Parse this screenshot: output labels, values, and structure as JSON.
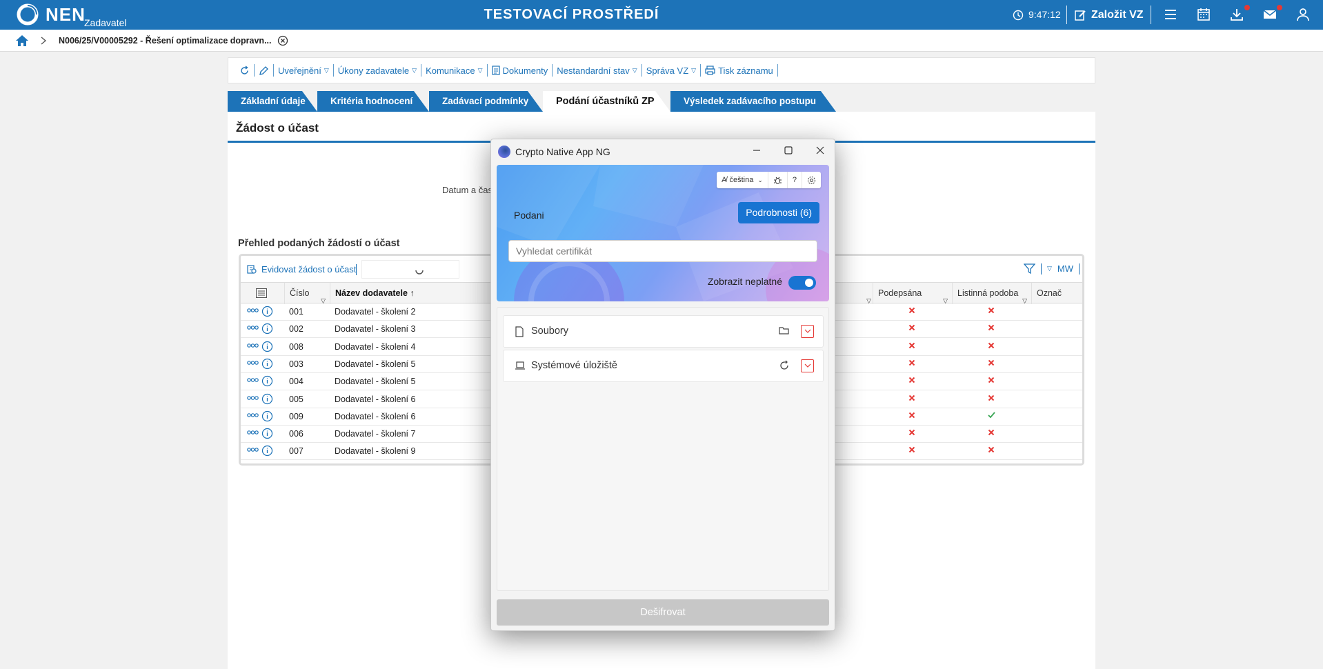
{
  "topbar": {
    "logo_text": "NEN",
    "logo_sub": "Zadavatel",
    "env_title": "TESTOVACÍ PROSTŘEDÍ",
    "time": "9:47:12",
    "create_label": "Založit VZ",
    "brand_color": "#1d73b8"
  },
  "breadcrumb": {
    "title": "N006/25/V00005292 - Řešení optimalizace dopravn..."
  },
  "toolbar": {
    "items": [
      "Uveřejnění",
      "Úkony zadavatele",
      "Komunikace",
      "Dokumenty",
      "Nestandardní stav",
      "Správa VZ",
      "Tisk záznamu"
    ]
  },
  "tabs": [
    "Základní údaje",
    "Kritéria hodnocení",
    "Zadávací podmínky",
    "Podání účastníků ZP",
    "Výsledek zadávacího postupu"
  ],
  "panel": {
    "title": "Žádost o účast",
    "datum_label": "Datum a čas",
    "section_title": "Přehled podaných žádostí o účast",
    "evidovat_label": "Evidovat žádost o účast",
    "mw_label": "MW"
  },
  "grid": {
    "columns": [
      "Číslo",
      "Název dodavatele",
      "Podepsána",
      "Listinná podoba",
      "Označ"
    ],
    "rows": [
      {
        "cislo": "001",
        "nazev": "Dodavatel - školení 2",
        "podepsana": "no",
        "listinna": "no"
      },
      {
        "cislo": "002",
        "nazev": "Dodavatel - školení 3",
        "podepsana": "no",
        "listinna": "no"
      },
      {
        "cislo": "008",
        "nazev": "Dodavatel - školení 4",
        "podepsana": "no",
        "listinna": "no"
      },
      {
        "cislo": "003",
        "nazev": "Dodavatel - školení 5",
        "podepsana": "no",
        "listinna": "no"
      },
      {
        "cislo": "004",
        "nazev": "Dodavatel - školení 5",
        "podepsana": "no",
        "listinna": "no"
      },
      {
        "cislo": "005",
        "nazev": "Dodavatel - školení 6",
        "podepsana": "no",
        "listinna": "no"
      },
      {
        "cislo": "009",
        "nazev": "Dodavatel - školení 6",
        "podepsana": "no",
        "listinna": "yes"
      },
      {
        "cislo": "006",
        "nazev": "Dodavatel - školení 7",
        "podepsana": "no",
        "listinna": "no"
      },
      {
        "cislo": "007",
        "nazev": "Dodavatel - školení 9",
        "podepsana": "no",
        "listinna": "no"
      }
    ]
  },
  "modal": {
    "title": "Crypto Native App NG",
    "language": "čeština",
    "podani_label": "Podani",
    "details_button": "Podrobnosti (6)",
    "search_placeholder": "Vyhledat certifikát",
    "toggle_label": "Zobrazit neplatné",
    "toggle_on": true,
    "sections": [
      "Soubory",
      "Systémové úložiště"
    ],
    "decrypt_button": "Dešifrovat"
  }
}
